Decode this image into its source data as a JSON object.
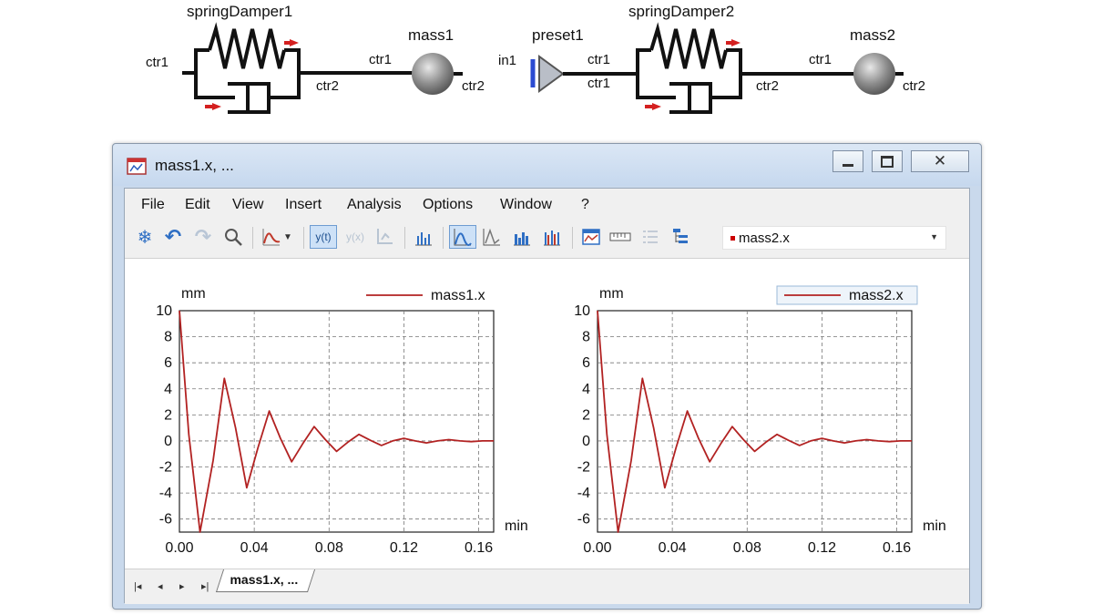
{
  "diagram": {
    "blocks": [
      {
        "name": "springDamper1"
      },
      {
        "name": "mass1"
      },
      {
        "name": "preset1"
      },
      {
        "name": "springDamper2"
      },
      {
        "name": "mass2"
      }
    ],
    "ports": {
      "sd1_ctr1": "ctr1",
      "sd1_ctr2": "ctr2",
      "m1_ctr1": "ctr1",
      "m1_ctr2": "ctr2",
      "p1_in1": "in1",
      "p1_ctr1": "ctr1",
      "sd2_ctr1": "ctr1",
      "sd2_ctr2": "ctr2",
      "m2_ctr1": "ctr1",
      "m2_ctr2": "ctr2"
    }
  },
  "window": {
    "title": "mass1.x, ...",
    "controls": [
      "minimize-icon",
      "restore-icon",
      "close-icon"
    ]
  },
  "menu": [
    "File",
    "Edit",
    "View",
    "Insert",
    "Analysis",
    "Options",
    "Window",
    "?"
  ],
  "toolbar": {
    "icons": [
      "snowflake-icon",
      "undo-icon",
      "redo-icon",
      "zoom-icon",
      "curve-style-icon",
      "dropdown-arrow-icon",
      "y-of-t-icon",
      "y-of-x-icon",
      "axis-icon",
      "bar-chart-icon",
      "line-chart-icon",
      "peak-icon",
      "histogram-icon",
      "multi-bar-icon",
      "chart-window-icon",
      "ruler-icon",
      "list-icon",
      "tree-icon"
    ],
    "yt_label": "y(t)",
    "yx_label": "y(x)",
    "selected_signal": "mass2.x",
    "selected_signal_color": "#cc0000"
  },
  "plots": [
    {
      "unit": "mm",
      "legend": "mass1.x"
    },
    {
      "unit": "mm",
      "legend": "mass2.x"
    }
  ],
  "chart_data": [
    {
      "type": "line",
      "ylabel": "mm",
      "xlabel": "min",
      "xlim": [
        0,
        0.168
      ],
      "ylim": [
        -7,
        10
      ],
      "xticks": [
        "0.00",
        "0.04",
        "0.08",
        "0.12",
        "0.16"
      ],
      "yticks": [
        "10",
        "8",
        "6",
        "4",
        "2",
        "0",
        "-2",
        "-4",
        "-6"
      ],
      "grid": true,
      "legend_position": "top-right",
      "series": [
        {
          "name": "mass1.x",
          "color": "#b22222",
          "x": [
            0.0,
            0.005,
            0.011,
            0.018,
            0.024,
            0.03,
            0.036,
            0.042,
            0.048,
            0.054,
            0.06,
            0.066,
            0.072,
            0.078,
            0.084,
            0.09,
            0.096,
            0.102,
            0.108,
            0.114,
            0.12,
            0.126,
            0.132,
            0.138,
            0.144,
            0.15,
            0.156,
            0.162,
            0.168
          ],
          "y": [
            10.0,
            0.5,
            -7.0,
            -1.5,
            4.8,
            1.0,
            -3.6,
            -0.5,
            2.3,
            0.2,
            -1.6,
            -0.2,
            1.1,
            0.1,
            -0.8,
            -0.1,
            0.5,
            0.05,
            -0.35,
            0.0,
            0.2,
            0.0,
            -0.15,
            0.0,
            0.1,
            0.0,
            -0.05,
            0.0,
            0.0
          ]
        }
      ]
    },
    {
      "type": "line",
      "ylabel": "mm",
      "xlabel": "min",
      "xlim": [
        0,
        0.168
      ],
      "ylim": [
        -7,
        10
      ],
      "xticks": [
        "0.00",
        "0.04",
        "0.08",
        "0.12",
        "0.16"
      ],
      "yticks": [
        "10",
        "8",
        "6",
        "4",
        "2",
        "0",
        "-2",
        "-4",
        "-6"
      ],
      "grid": true,
      "legend_position": "top-right",
      "series": [
        {
          "name": "mass2.x",
          "color": "#b22222",
          "x": [
            0.0,
            0.005,
            0.011,
            0.018,
            0.024,
            0.03,
            0.036,
            0.042,
            0.048,
            0.054,
            0.06,
            0.066,
            0.072,
            0.078,
            0.084,
            0.09,
            0.096,
            0.102,
            0.108,
            0.114,
            0.12,
            0.126,
            0.132,
            0.138,
            0.144,
            0.15,
            0.156,
            0.162,
            0.168
          ],
          "y": [
            10.0,
            0.5,
            -7.0,
            -1.5,
            4.8,
            1.0,
            -3.6,
            -0.5,
            2.3,
            0.2,
            -1.6,
            -0.2,
            1.1,
            0.1,
            -0.8,
            -0.1,
            0.5,
            0.05,
            -0.35,
            0.0,
            0.2,
            0.0,
            -0.15,
            0.0,
            0.1,
            0.0,
            -0.05,
            0.0,
            0.0
          ]
        }
      ]
    }
  ],
  "sheet_tabs": {
    "nav": [
      "|◂",
      "◂",
      "▸",
      "▸|"
    ],
    "active": "mass1.x, ..."
  }
}
